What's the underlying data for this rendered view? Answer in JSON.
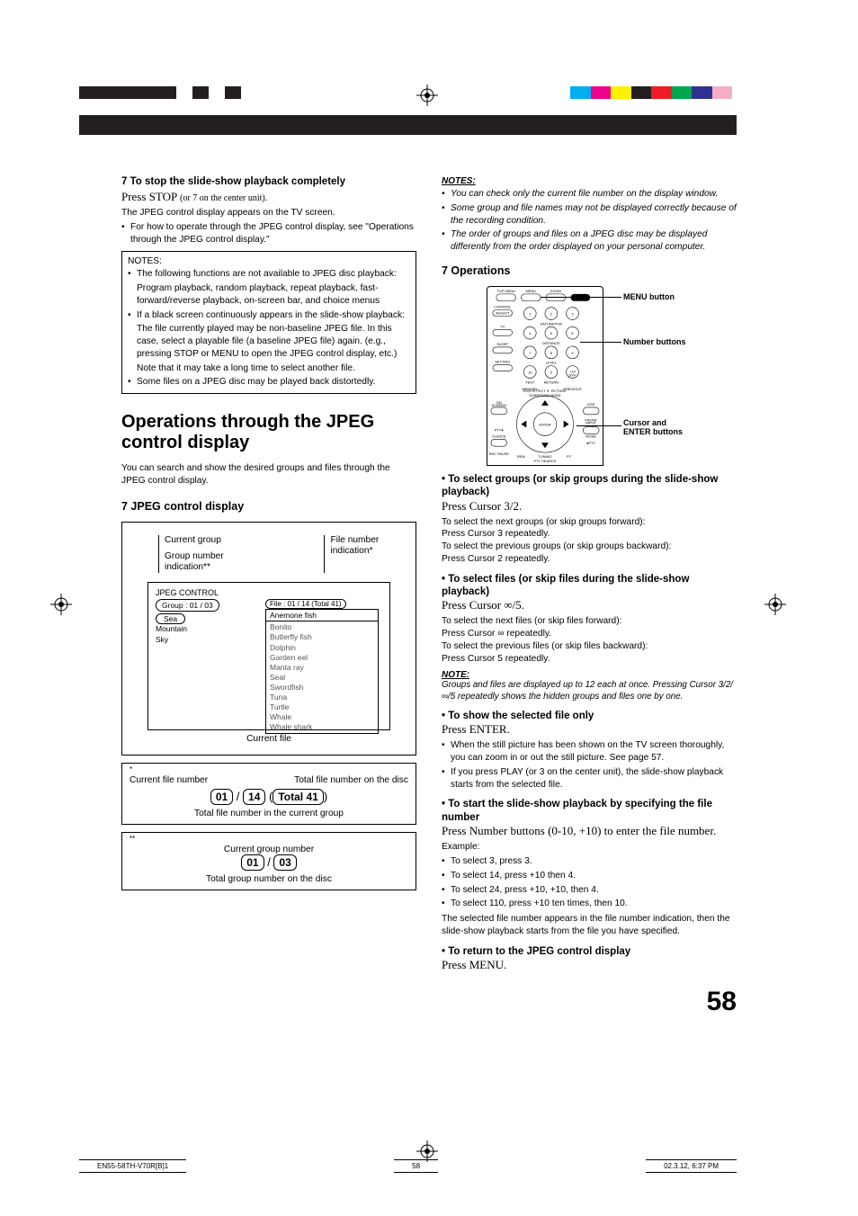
{
  "top_left": {
    "h_stop": "7 To stop the slide-show playback completely",
    "press_stop": "Press STOP ",
    "press_stop_small": "(or 7 on the center unit).",
    "line1": "The JPEG control display appears on the TV screen.",
    "bullet1": "For how to operate through the JPEG control display, see \"Operations through the JPEG control display.\"",
    "notes_label": "NOTES:",
    "note1": "The following functions are not available to JPEG disc playback:",
    "note1_sub": "Program playback, random playback, repeat playback, fast-forward/reverse playback, on-screen bar, and choice menus",
    "note2": "If a black screen continuously appears in the slide-show playback:",
    "note2_sub1": "The file currently played may be non-baseline JPEG file. In this case, select a playable file (a baseline JPEG file) again. (e.g., pressing STOP or MENU to open the JPEG control display, etc.)",
    "note2_sub2": "Note that it may take a long time to select another file.",
    "note3": "Some files on a JPEG disc may be played back distortedly."
  },
  "section_title": "Operations through the JPEG control display",
  "intro": "You can search and show the desired groups and files through the JPEG control display.",
  "jpeg_hdr": "7 JPEG control display",
  "diag": {
    "cur_group": "Current group",
    "grp_num_ind": "Group number indication**",
    "file_num_ind": "File number indication*",
    "panel_title": "JPEG CONTROL",
    "group_line": "Group :  01 / 03",
    "sea": "Sea",
    "mountain": "Mountain",
    "sky": "Sky",
    "file_line": "File :  01 / 14 (Total 41)",
    "anemone": "Anemone fish",
    "files": [
      "Bonito",
      "Butterfly fish",
      "Dolphin",
      "Garden eel",
      "Manta ray",
      "Seal",
      "Swordfish",
      "Tuna",
      "Turtle",
      "Whale",
      "Whale shark"
    ],
    "current_file": "Current file",
    "cfn": "Current file number",
    "tfn_disc": "Total file number on the disc",
    "n01": "01",
    "n14": "14",
    "t41": "Total 41",
    "tfn_group": "Total file number in the current group",
    "cgn": "Current group number",
    "g01": "01",
    "g03": "03",
    "tgn_disc": "Total group number on the disc",
    "ast": "*",
    "ast2": "**"
  },
  "right": {
    "notes_hdr": "NOTES:",
    "n1": "You can check only the current file number on the display window.",
    "n2": "Some group and file names may not be displayed correctly because of the recording condition.",
    "n3": "The order of groups and files on a JPEG disc may be displayed differently from the order displayed on your personal computer.",
    "ops_hdr": "7 Operations",
    "remote": {
      "menu_btn": "MENU button",
      "num_btn": "Number buttons",
      "cursor_enter": "Cursor and ENTER buttons",
      "labels": [
        "TOP MENU",
        "MENU",
        "ZOOM",
        "CONTROL",
        "ADJUST",
        "TV",
        "SATURATION",
        "SLEEP",
        "DISTANCE",
        "SETTING",
        "LEVEL",
        "10",
        "0",
        "+10",
        "100+",
        "TEST",
        "RETURN",
        "MEMORY",
        "PREVIOUS",
        "REC PAUSE",
        "ON SCREEN",
        "DSP",
        "FRONT INPUT MODE",
        "CHOICE",
        "ENTER",
        "SURROUND MODE",
        "REW",
        "DVD EFFECT",
        "FF",
        "TUNING",
        "S. PICTURE",
        "PTY SEARCH"
      ]
    },
    "op1": {
      "head": "• To select groups (or skip groups during the slide-show playback)",
      "press": "Press Cursor 3/2.",
      "l1": "To select the next groups (or skip groups forward):",
      "l2": "Press Cursor 3 repeatedly.",
      "l3": "To select the previous groups (or skip groups backward):",
      "l4": "Press Cursor 2 repeatedly."
    },
    "op2": {
      "head": "• To select files (or skip files during the slide-show playback)",
      "press": "Press Cursor ∞/5.",
      "l1": "To select the next files (or skip files forward):",
      "l2": "Press Cursor ∞ repeatedly.",
      "l3": "To select the previous files (or skip files backward):",
      "l4": "Press Cursor 5 repeatedly."
    },
    "note_hdr2": "NOTE:",
    "note2": "Groups and files are displayed up to 12 each at once. Pressing Cursor 3/2/∞/5 repeatedly shows the hidden groups and files one by one.",
    "op3": {
      "head": "• To show the selected file only",
      "press": "Press ENTER.",
      "b1": "When the still picture has been shown on the TV screen thoroughly, you can zoom in or out the still picture. See page 57.",
      "b2": "If you press PLAY (or 3 on the center unit), the slide-show playback starts from the selected file."
    },
    "op4": {
      "head": "• To start the slide-show playback by specifying the file number",
      "press": "Press Number buttons (0-10, +10) to enter the file number.",
      "ex": "Example:",
      "e1": "To select 3, press 3.",
      "e2": "To select 14, press +10 then 4.",
      "e3": "To select 24, press +10, +10, then 4.",
      "e4": "To select 110, press +10 ten times, then 10.",
      "trail": "The selected file number appears in the file number indication, then the slide-show playback starts from the file you have specified."
    },
    "op5": {
      "head": "• To return to the JPEG control display",
      "press": "Press MENU."
    }
  },
  "page_num": "58",
  "footer": {
    "left": "EN55-58TH-V70R[B]1",
    "mid": "58",
    "right": "02.3.12, 6:37 PM"
  }
}
